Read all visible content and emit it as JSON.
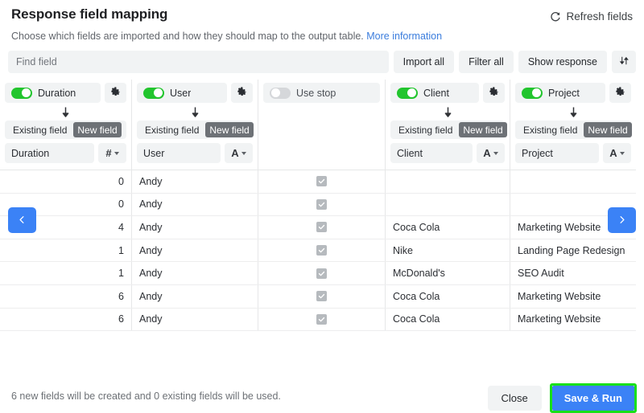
{
  "header": {
    "title": "Response field mapping",
    "refresh_label": "Refresh fields",
    "refresh_icon": "refresh-icon",
    "subtitle_text": "Choose which fields are imported and how they should map to the output table.",
    "subtitle_link": "More information"
  },
  "toolbar": {
    "find_placeholder": "Find field",
    "find_value": "",
    "import_all": "Import all",
    "filter_all": "Filter all",
    "show_response": "Show response",
    "sort_icon": "sort-updown-icon"
  },
  "segmented": {
    "existing": "Existing field",
    "new": "New field"
  },
  "columns": [
    {
      "source": "Duration",
      "enabled": true,
      "has_gear": true,
      "has_mapping": true,
      "mode": "New field",
      "target_name": "Duration",
      "type_symbol": "#",
      "type_name": "number"
    },
    {
      "source": "User",
      "enabled": true,
      "has_gear": true,
      "has_mapping": true,
      "mode": "New field",
      "target_name": "User",
      "type_symbol": "A",
      "type_name": "text"
    },
    {
      "source": "Use stop",
      "enabled": false,
      "has_gear": false,
      "has_mapping": false,
      "mode": "",
      "target_name": "",
      "type_symbol": "",
      "type_name": ""
    },
    {
      "source": "Client",
      "enabled": true,
      "has_gear": true,
      "has_mapping": true,
      "mode": "New field",
      "target_name": "Client",
      "type_symbol": "A",
      "type_name": "text"
    },
    {
      "source": "Project",
      "enabled": true,
      "has_gear": true,
      "has_mapping": true,
      "mode": "New field",
      "target_name": "Project",
      "type_symbol": "A",
      "type_name": "text"
    }
  ],
  "rows": [
    {
      "duration": "0",
      "user": "Andy",
      "use_stop": true,
      "client": "",
      "project": ""
    },
    {
      "duration": "0",
      "user": "Andy",
      "use_stop": true,
      "client": "",
      "project": ""
    },
    {
      "duration": "4",
      "user": "Andy",
      "use_stop": true,
      "client": "Coca Cola",
      "project": "Marketing Website"
    },
    {
      "duration": "1",
      "user": "Andy",
      "use_stop": true,
      "client": "Nike",
      "project": "Landing Page Redesign"
    },
    {
      "duration": "1",
      "user": "Andy",
      "use_stop": true,
      "client": "McDonald's",
      "project": "SEO Audit"
    },
    {
      "duration": "6",
      "user": "Andy",
      "use_stop": true,
      "client": "Coca Cola",
      "project": "Marketing Website"
    },
    {
      "duration": "6",
      "user": "Andy",
      "use_stop": true,
      "client": "Coca Cola",
      "project": "Marketing Website"
    }
  ],
  "nav": {
    "prev_icon": "chevron-left-icon",
    "next_icon": "chevron-right-icon"
  },
  "footer": {
    "summary": "6 new fields will be created and 0 existing fields will be used.",
    "close": "Close",
    "save_run": "Save & Run"
  },
  "colors": {
    "accent_blue": "#3b82f6",
    "toggle_on_green": "#22c52e",
    "highlight_green": "#18e018",
    "link_blue": "#3b7ddd",
    "chrome_grey": "#f1f3f4"
  }
}
